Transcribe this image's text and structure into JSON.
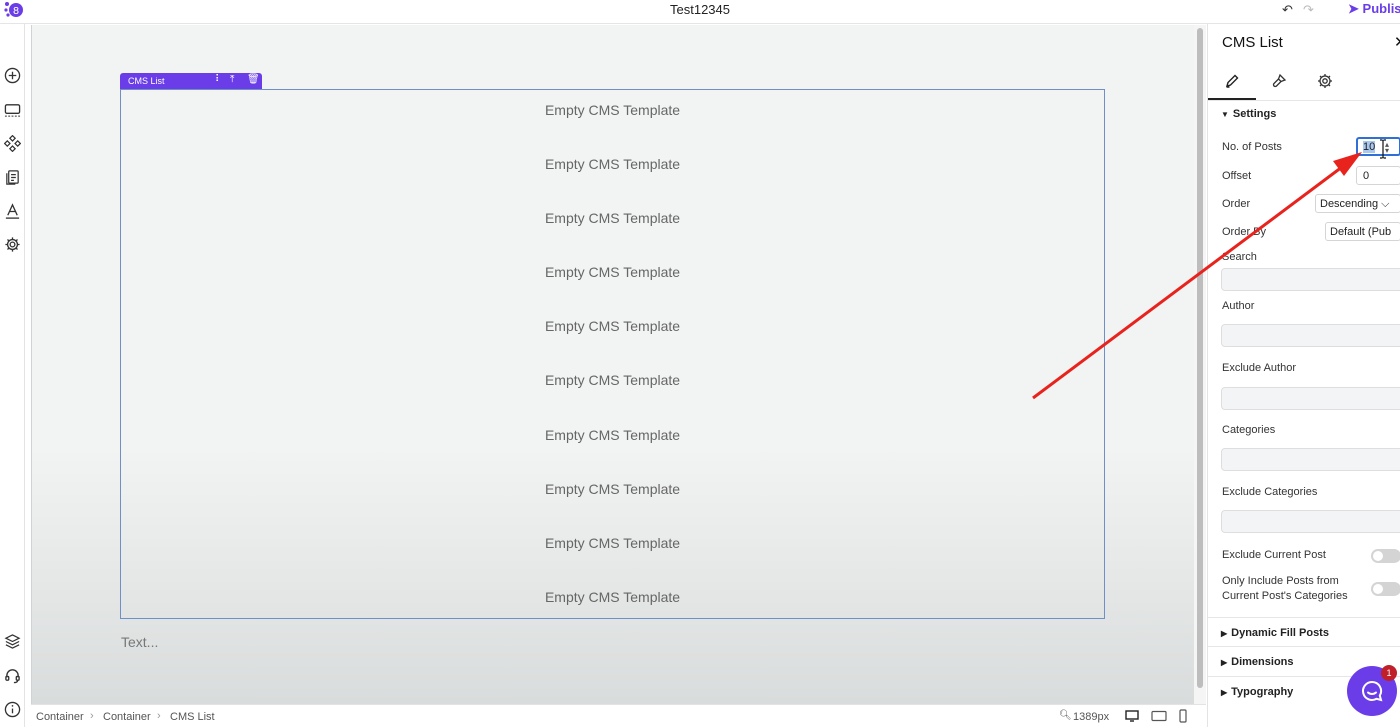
{
  "header": {
    "title": "Test12345",
    "publish_label": "Publis",
    "accent_color": "#6a3de8"
  },
  "toolbar_icons": [
    "add-icon",
    "section-icon",
    "components-icon",
    "pages-icon",
    "typography-icon",
    "settings-icon",
    "layers-icon",
    "support-icon",
    "info-icon"
  ],
  "canvas": {
    "cms_tag_label": "CMS List",
    "template_label": "Empty CMS Template",
    "template_count": 10,
    "text_placeholder": "Text..."
  },
  "statusbar": {
    "breadcrumbs": [
      "Container",
      "Container",
      "CMS List"
    ],
    "zoom": "1389px"
  },
  "panel": {
    "title": "CMS List",
    "tabs": [
      "edit-tab",
      "style-tab",
      "settings-tab"
    ],
    "settings_heading": "Settings",
    "no_of_posts_label": "No. of Posts",
    "no_of_posts_value": "10",
    "offset_label": "Offset",
    "offset_value": "0",
    "order_label": "Order",
    "order_value": "Descending",
    "order_by_label": "Order By",
    "order_by_value": "Default (Pub",
    "search_label": "Search",
    "author_label": "Author",
    "exclude_author_label": "Exclude Author",
    "categories_label": "Categories",
    "exclude_categories_label": "Exclude Categories",
    "exclude_current_post_label": "Exclude Current Post",
    "only_include_label_line1": "Only Include Posts from",
    "only_include_label_line2": "Current Post's Categories",
    "dynamic_fill_label": "Dynamic Fill Posts",
    "dimensions_label": "Dimensions",
    "typography_label": "Typography"
  },
  "chat": {
    "badge_count": "1"
  },
  "annotation": {
    "arrow_color": "#e8231e"
  }
}
